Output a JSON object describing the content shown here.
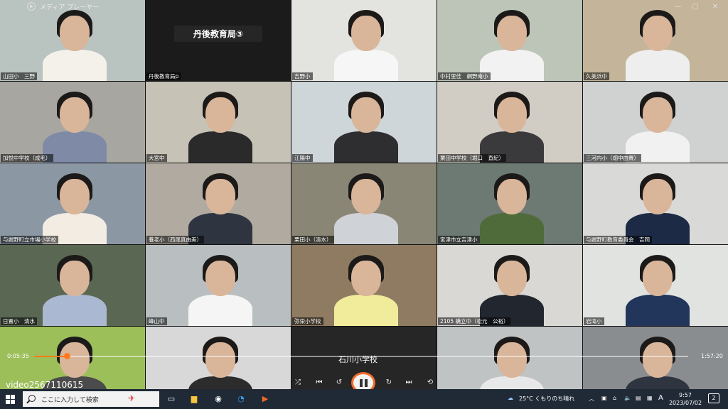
{
  "window": {
    "app_title": "メディア プレーヤー"
  },
  "tiles": [
    {
      "name": "山田小　三野"
    },
    {
      "name": "丹後教育局p",
      "banner": "丹後教育局③"
    },
    {
      "name": "吉野小"
    },
    {
      "name": "中村里佳　網野南小"
    },
    {
      "name": "久美浜中"
    },
    {
      "name": "加悦中学校（成毛）"
    },
    {
      "name": "大宮中"
    },
    {
      "name": "江陽中"
    },
    {
      "name": "栗田中学校（堀口　直紀）"
    },
    {
      "name": "三河内小（畑中由貴）"
    },
    {
      "name": "与謝野町立市場小学校"
    },
    {
      "name": "養老小（西尾真由美）"
    },
    {
      "name": "栗田小（清水）"
    },
    {
      "name": "宮津市立吉津小"
    },
    {
      "name": "与謝野町教育委員会　吉岡"
    },
    {
      "name": "日置小　清水"
    },
    {
      "name": "峰山中"
    },
    {
      "name": "弥栄小学校"
    },
    {
      "name": "2105 橋立中（松元　公裕）"
    },
    {
      "name": "岩滝小"
    },
    {
      "name": ""
    },
    {
      "name": ""
    },
    {
      "name": ""
    },
    {
      "name": ""
    },
    {
      "name": ""
    }
  ],
  "player": {
    "video_title": "石川小学校",
    "elapsed": "0:05:35",
    "total": "1:57:20",
    "progress": 0.05
  },
  "watermark": "video2567110615",
  "taskbar": {
    "search_placeholder": "ここに入力して検索",
    "weather": "25°C くもりのち晴れ",
    "ime": "A",
    "time": "9:57",
    "date": "2023/07/02",
    "notifications": "2"
  }
}
